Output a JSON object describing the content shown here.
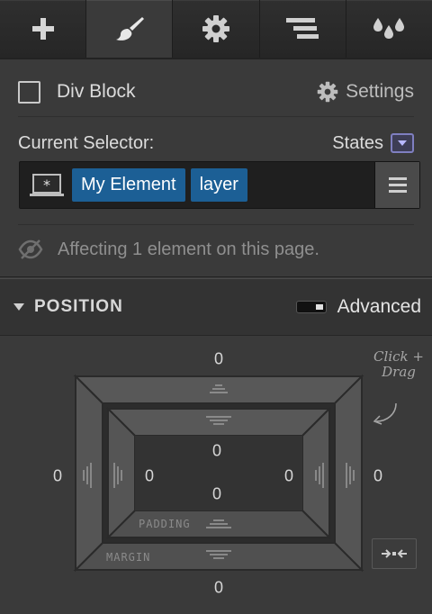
{
  "tabs": [
    {
      "name": "add",
      "icon": "plus-icon"
    },
    {
      "name": "style",
      "icon": "brush-icon",
      "active": true
    },
    {
      "name": "settings",
      "icon": "gear-icon"
    },
    {
      "name": "navigator",
      "icon": "navigator-icon"
    },
    {
      "name": "swatches",
      "icon": "drops-icon"
    }
  ],
  "element": {
    "type_label": "Div Block",
    "settings_label": "Settings"
  },
  "selector": {
    "label": "Current Selector:",
    "states_label": "States",
    "chips": [
      "My Element",
      "layer"
    ],
    "affecting_text": "Affecting 1 element on this page."
  },
  "position": {
    "title": "POSITION",
    "advanced_label": "Advanced",
    "hint": "Click + Drag",
    "padding_label": "PADDING",
    "margin_label": "MARGIN",
    "margin": {
      "top": "0",
      "right": "0",
      "bottom": "0",
      "left": "0"
    },
    "padding": {
      "top": "0",
      "right": "0",
      "bottom": "0",
      "left": "0"
    }
  },
  "colors": {
    "chip": "#1c5f95",
    "states_accent": "#7f7fc0",
    "panel": "#3a3a3a"
  }
}
